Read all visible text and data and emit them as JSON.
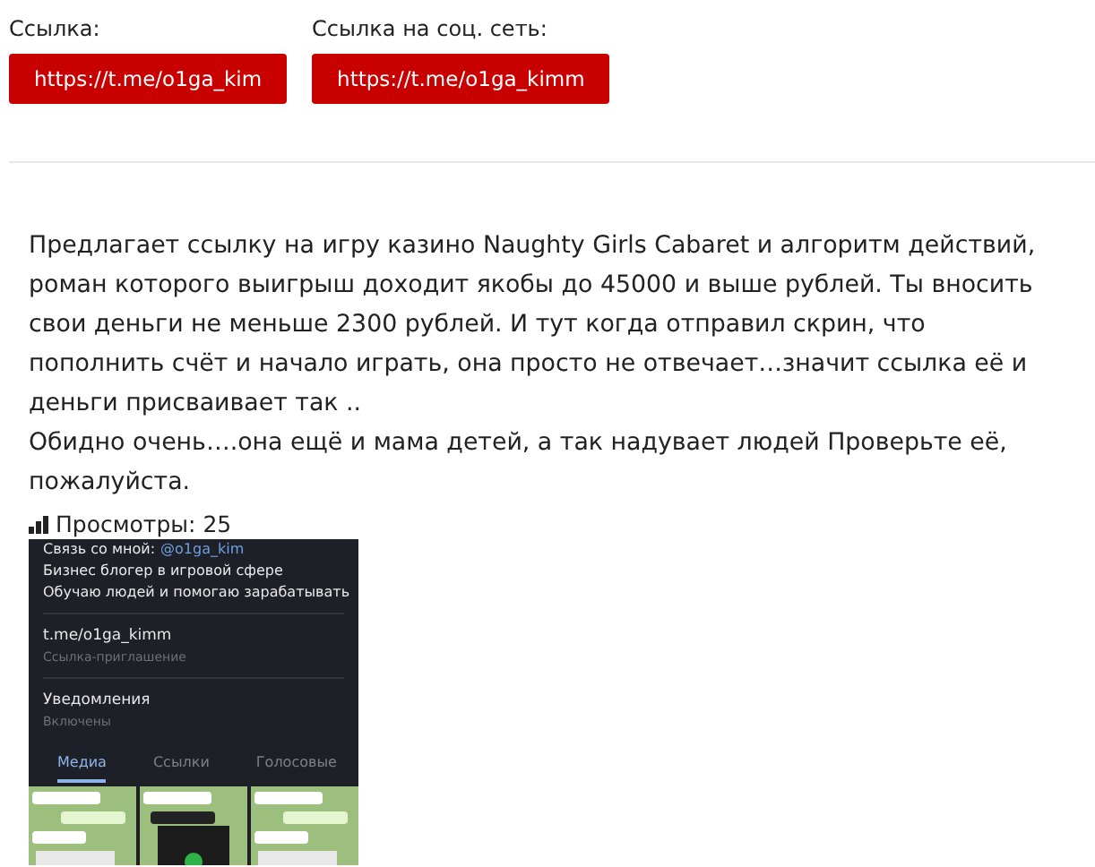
{
  "links": [
    {
      "label": "Ссылка:",
      "button": "https://t.me/o1ga_kim"
    },
    {
      "label": "Ссылка на соц. сеть:",
      "button": "https://t.me/o1ga_kimm"
    }
  ],
  "post": {
    "paragraphs": [
      "Предлагает ссылку на игру казино Naughty Girls Cabaret и алгоритм действий, роман которого выигрыш доходит якобы до 45000 и выше рублей. Ты вносить свои деньги не меньше 2300 рублей. И тут когда отправил скрин, что пополнить счёт и начало играть, она просто не отвечает…значит ссылка её и деньги присваивает так ..",
      "Обидно очень….она ещё и мама детей, а так надувает людей Проверьте её, пожалуйста."
    ],
    "views": "Просмотры: 25"
  },
  "screenshot": {
    "contact_label": "Связь со мной:",
    "contact_handle": "@o1ga_kim",
    "bio": [
      "Бизнес блогер в игровой сфере",
      "Обучаю людей и помогаю зарабатывать"
    ],
    "link": "t.me/o1ga_kimm",
    "link_caption": "Ссылка-приглашение",
    "setting": "Уведомления",
    "setting_value": "Включены",
    "tabs": [
      {
        "label": "Медиа",
        "selected": true
      },
      {
        "label": "Ссылки",
        "selected": false
      },
      {
        "label": "Голосовые",
        "selected": false
      }
    ],
    "thumbnails": [
      {
        "kind": "picture"
      },
      {
        "kind": "picture"
      },
      {
        "kind": "picture"
      }
    ]
  }
}
